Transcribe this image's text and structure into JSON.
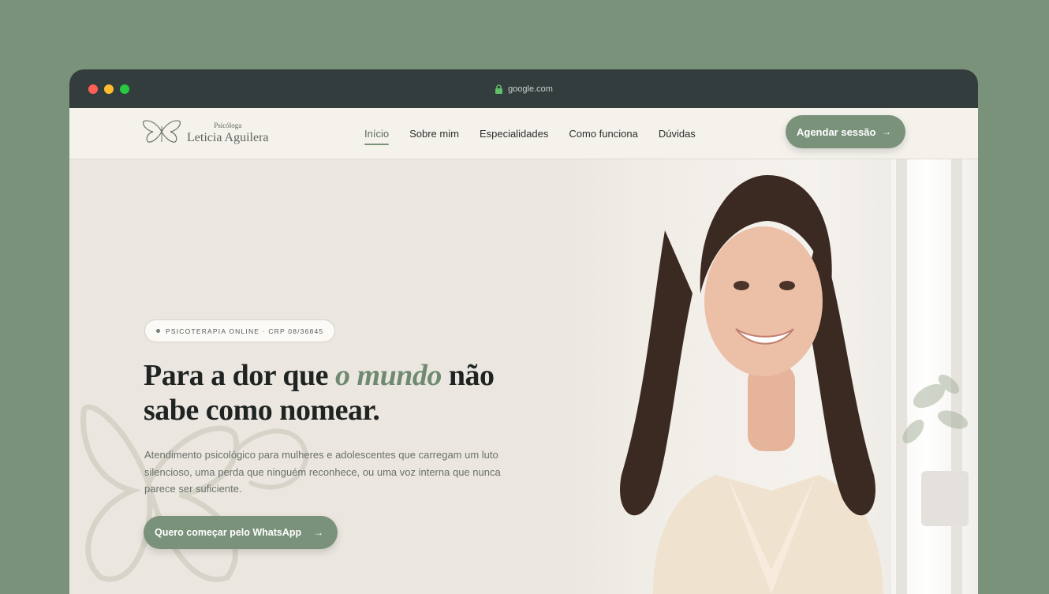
{
  "browser": {
    "url": "google.com"
  },
  "nav": {
    "logo_subtitle": "Psicóloga",
    "logo_name": "Leticia Aguilera",
    "links": [
      "Início",
      "Sobre mim",
      "Especialidades",
      "Como funciona",
      "Dúvidas"
    ],
    "active_index": 0,
    "cta_label": "Agendar sessão",
    "cta_arrow": "→"
  },
  "hero": {
    "badge": "PSICOTERAPIA ONLINE · CRP 08/36845",
    "headline_before": "Para a dor que ",
    "headline_accent": "o mundo",
    "headline_after": " não sabe como nomear.",
    "subtext": "Atendimento psicológico para mulheres e adolescentes que carregam um luto silencioso, uma perda que ninguém reconhece, ou uma voz interna que nunca parece ser suficiente.",
    "cta_label": "Quero começar pelo WhatsApp",
    "cta_arrow": "→"
  },
  "colors": {
    "page_bg": "#7a917a",
    "titlebar": "#333d3d",
    "accent": "#7a917a",
    "accent_text": "#6f8a70",
    "hero_bg": "#ebe7e0"
  },
  "icons": {
    "lock": "lock-icon",
    "logo": "butterfly-logo-icon",
    "arrow": "arrow-right-icon"
  }
}
